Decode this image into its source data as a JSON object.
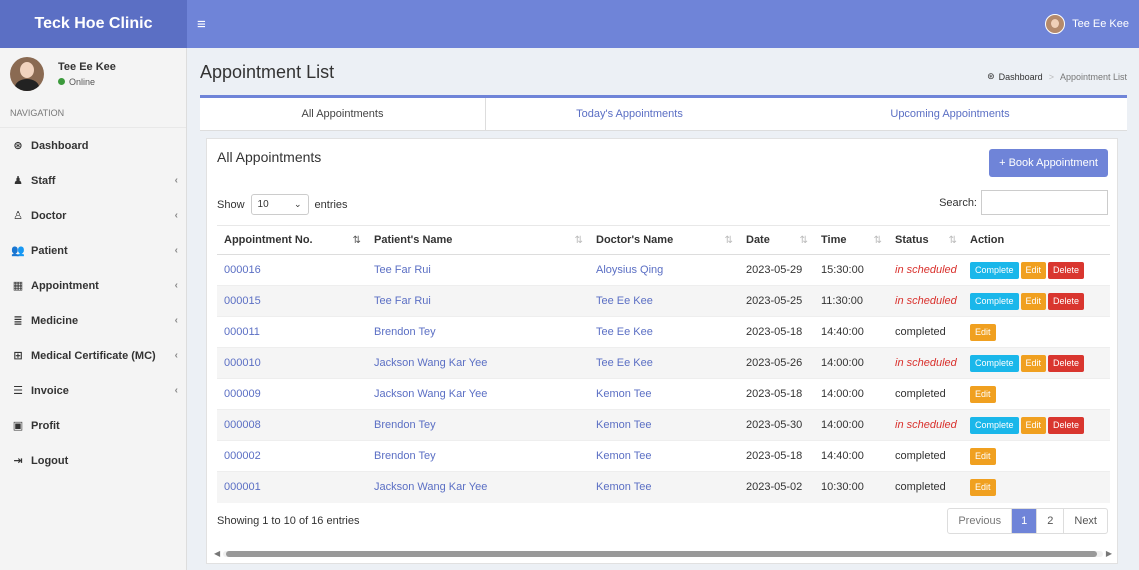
{
  "app": {
    "brand": "Teck Hoe Clinic",
    "menu_icon": "hamburger-icon"
  },
  "topbar": {
    "user_name": "Tee Ee Kee"
  },
  "sidebar": {
    "user": {
      "name": "Tee Ee Kee",
      "status": "Online"
    },
    "nav_header": "NAVIGATION",
    "items": [
      {
        "label": "Dashboard",
        "icon": "dashboard-icon",
        "glyph": "⊛",
        "arrow": ""
      },
      {
        "label": "Staff",
        "icon": "staff-icon",
        "glyph": "♟",
        "arrow": "‹"
      },
      {
        "label": "Doctor",
        "icon": "doctor-icon",
        "glyph": "♙",
        "arrow": "‹"
      },
      {
        "label": "Patient",
        "icon": "patient-icon",
        "glyph": "👥",
        "arrow": "‹"
      },
      {
        "label": "Appointment",
        "icon": "calendar-icon",
        "glyph": "▦",
        "arrow": "‹"
      },
      {
        "label": "Medicine",
        "icon": "database-icon",
        "glyph": "≣",
        "arrow": "‹"
      },
      {
        "label": "Medical Certificate (MC)",
        "icon": "plus-square-icon",
        "glyph": "⊞",
        "arrow": "‹"
      },
      {
        "label": "Invoice",
        "icon": "list-icon",
        "glyph": "☰",
        "arrow": "‹"
      },
      {
        "label": "Profit",
        "icon": "money-icon",
        "glyph": "▣",
        "arrow": ""
      },
      {
        "label": "Logout",
        "icon": "logout-icon",
        "glyph": "⇥",
        "arrow": ""
      }
    ]
  },
  "header": {
    "title": "Appointment List",
    "breadcrumb": {
      "home": "Dashboard",
      "current": "Appointment List"
    }
  },
  "tabs": {
    "all": "All Appointments",
    "today": "Today's Appointments",
    "upcoming": "Upcoming Appointments"
  },
  "box": {
    "title": "All Appointments",
    "book_button": "+ Book Appointment",
    "show_label": "Show",
    "entries_value": "10",
    "entries_label": "entries",
    "search_label": "Search:"
  },
  "table": {
    "columns": [
      "Appointment No.",
      "Patient's Name",
      "Doctor's Name",
      "Date",
      "Time",
      "Status",
      "Action"
    ],
    "rows": [
      {
        "no": "000016",
        "patient": "Tee Far Rui",
        "doctor": "Aloysius Qing",
        "date": "2023-05-29",
        "time": "15:30:00",
        "status": "in scheduled",
        "actions": [
          "Complete",
          "Edit",
          "Delete"
        ]
      },
      {
        "no": "000015",
        "patient": "Tee Far Rui",
        "doctor": "Tee Ee Kee",
        "date": "2023-05-25",
        "time": "11:30:00",
        "status": "in scheduled",
        "actions": [
          "Complete",
          "Edit",
          "Delete"
        ]
      },
      {
        "no": "000011",
        "patient": "Brendon Tey",
        "doctor": "Tee Ee Kee",
        "date": "2023-05-18",
        "time": "14:40:00",
        "status": "completed",
        "actions": [
          "Edit"
        ]
      },
      {
        "no": "000010",
        "patient": "Jackson Wang Kar Yee",
        "doctor": "Tee Ee Kee",
        "date": "2023-05-26",
        "time": "14:00:00",
        "status": "in scheduled",
        "actions": [
          "Complete",
          "Edit",
          "Delete"
        ]
      },
      {
        "no": "000009",
        "patient": "Jackson Wang Kar Yee",
        "doctor": "Kemon Tee",
        "date": "2023-05-18",
        "time": "14:00:00",
        "status": "completed",
        "actions": [
          "Edit"
        ]
      },
      {
        "no": "000008",
        "patient": "Brendon Tey",
        "doctor": "Kemon Tee",
        "date": "2023-05-30",
        "time": "14:00:00",
        "status": "in scheduled",
        "actions": [
          "Complete",
          "Edit",
          "Delete"
        ]
      },
      {
        "no": "000002",
        "patient": "Brendon Tey",
        "doctor": "Kemon Tee",
        "date": "2023-05-18",
        "time": "14:40:00",
        "status": "completed",
        "actions": [
          "Edit"
        ]
      },
      {
        "no": "000001",
        "patient": "Jackson Wang Kar Yee",
        "doctor": "Kemon Tee",
        "date": "2023-05-02",
        "time": "10:30:00",
        "status": "completed",
        "actions": [
          "Edit"
        ]
      }
    ]
  },
  "footer": {
    "info": "Showing 1 to 10 of 16 entries",
    "pagination": {
      "previous": "Previous",
      "pages": [
        "1",
        "2"
      ],
      "active": "1",
      "next": "Next"
    }
  },
  "colors": {
    "primary": "#6f84d8",
    "brand_bg": "#5b6fc4",
    "complete": "#1ab7ea",
    "edit": "#f0a020",
    "delete": "#d9362f",
    "scheduled": "#d9302c"
  }
}
